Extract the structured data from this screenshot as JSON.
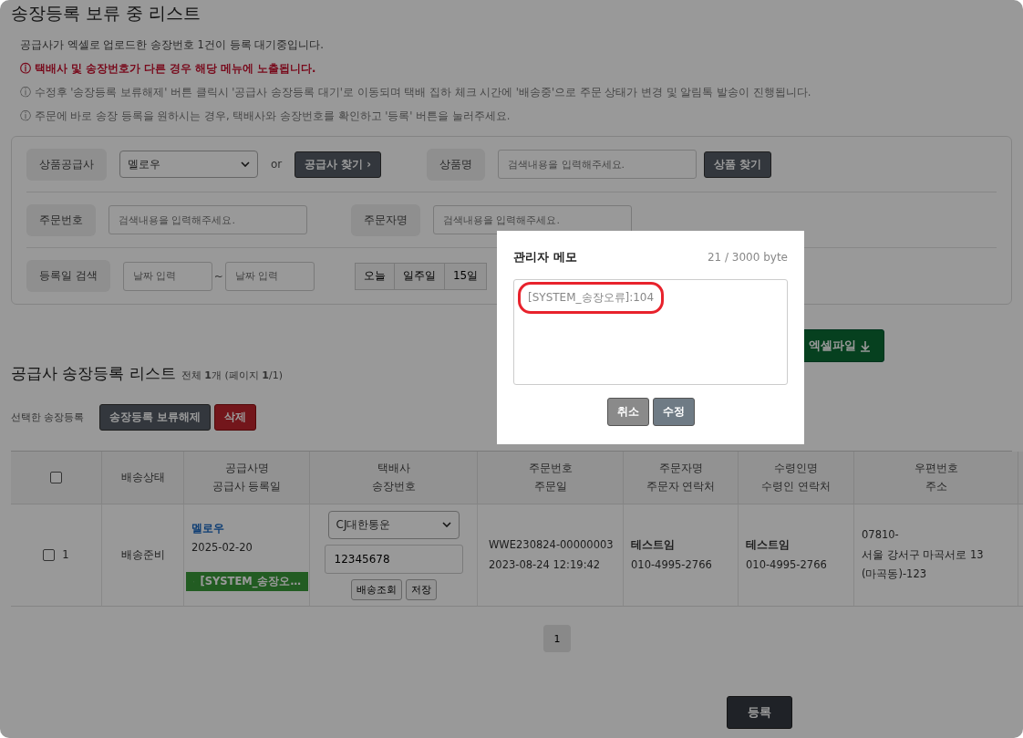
{
  "page_title": "송장등록 보류 중 리스트",
  "notices": [
    {
      "kind": "plain",
      "text": "공급사가 엑셀로 업로드한 송장번호 1건이 등록 대기중입니다."
    },
    {
      "kind": "alert",
      "text": "ⓘ 택배사 및 송장번호가 다른 경우 해당 메뉴에 노출됩니다."
    },
    {
      "kind": "hint",
      "text": "ⓘ 수정후 '송장등록 보류해제' 버튼 클릭시 '공급사 송장등록 대기'로 이동되며 택배 집하 체크 시간에 '배송중'으로 주문 상태가 변경 및 알림톡 발송이 진행됩니다."
    },
    {
      "kind": "hint",
      "text": "ⓘ 주문에 바로 송장 등록을 원하시는 경우, 택배사와 송장번호를 확인하고 '등록' 버튼을 눌러주세요."
    }
  ],
  "search": {
    "supplier_label": "상품공급사",
    "supplier_value": "멜로우",
    "or": "or",
    "find_supplier": "공급사 찾기 ›",
    "product_label": "상품명",
    "product_placeholder": "검색내용을 입력해주세요.",
    "find_product": "상품 찾기",
    "order_no_label": "주문번호",
    "order_no_placeholder": "검색내용을 입력해주세요.",
    "orderer_label": "주문자명",
    "orderer_placeholder": "검색내용을 입력해주세요.",
    "date_label": "등록일 검색",
    "date_from_placeholder": "날짜 입력",
    "tilde": "~",
    "date_to_placeholder": "날짜 입력",
    "periods": [
      "오늘",
      "일주일",
      "15일"
    ]
  },
  "excel_button": "엑셀파일",
  "list": {
    "title": "공급사 송장등록 리스트",
    "summary": "전체 **1**개 (페이지 **1**/1)",
    "selected_label": "선택한 송장등록",
    "release_button": "송장등록 보류해제",
    "delete_button": "삭제",
    "header_checked": false,
    "columns": [
      [
        "배송상태"
      ],
      [
        "공급사명",
        "공급사 등록일"
      ],
      [
        "택배사",
        "송장번호"
      ],
      [
        "주문번호",
        "주문일"
      ],
      [
        "주문자명",
        "주문자 연락처"
      ],
      [
        "수령인명",
        "수령인 연락처"
      ],
      [
        "우편번호",
        "주소"
      ]
    ],
    "rows": [
      {
        "checked": false,
        "no": "1",
        "status": "배송준비",
        "supplier": "멜로우",
        "registered": "2025-02-20",
        "memo": "[SYSTEM_송장오…",
        "courier": "CJ대한통운",
        "invoice": "12345678",
        "track_button": "배송조회",
        "save_button": "저장",
        "order_no": "WWE230824-00000003",
        "order_date": "2023-08-24 12:19:42",
        "orderer": "테스트임",
        "orderer_phone": "010-4995-2766",
        "receiver": "테스트임",
        "receiver_phone": "010-4995-2766",
        "zip": "07810-",
        "address": [
          "서울 강서구 마곡서로 13",
          "(마곡동)-123"
        ]
      }
    ]
  },
  "pages": [
    {
      "label": "1",
      "selected": true
    }
  ],
  "register_button": "등록",
  "modal": {
    "title": "관리자 메모",
    "counter": "21 / 3000 byte",
    "memo": "[SYSTEM_송장오류]:104",
    "cancel": "취소",
    "confirm": "수정"
  }
}
